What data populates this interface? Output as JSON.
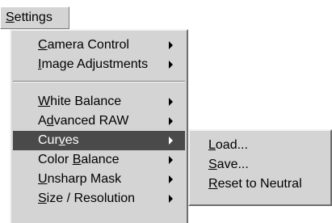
{
  "menubar": {
    "settings": {
      "pre": "",
      "key": "S",
      "post": "ettings"
    }
  },
  "settings_menu": {
    "items": [
      {
        "pre": "",
        "key": "C",
        "post": "amera Control"
      },
      {
        "pre": "",
        "key": "I",
        "post": "mage Adjustments"
      },
      {
        "pre": "",
        "key": "W",
        "post": "hite Balance"
      },
      {
        "pre": "A",
        "key": "d",
        "post": "vanced RAW"
      },
      {
        "pre": "Cur",
        "key": "v",
        "post": "es"
      },
      {
        "pre": "Color ",
        "key": "B",
        "post": "alance"
      },
      {
        "pre": "",
        "key": "U",
        "post": "nsharp Mask"
      },
      {
        "pre": "",
        "key": "S",
        "post": "ize / Resolution"
      }
    ],
    "selected_index": 4
  },
  "curves_submenu": {
    "items": [
      {
        "pre": "",
        "key": "L",
        "post": "oad..."
      },
      {
        "pre": "",
        "key": "S",
        "post": "ave..."
      },
      {
        "pre": "",
        "key": "R",
        "post": "eset to Neutral"
      }
    ]
  },
  "icons": {
    "submenu_arrow": "triangle-right-icon"
  },
  "colors": {
    "menu_background": "#d4d4d4",
    "highlight_background": "#4a4a4a",
    "highlight_text": "#ffffff"
  }
}
